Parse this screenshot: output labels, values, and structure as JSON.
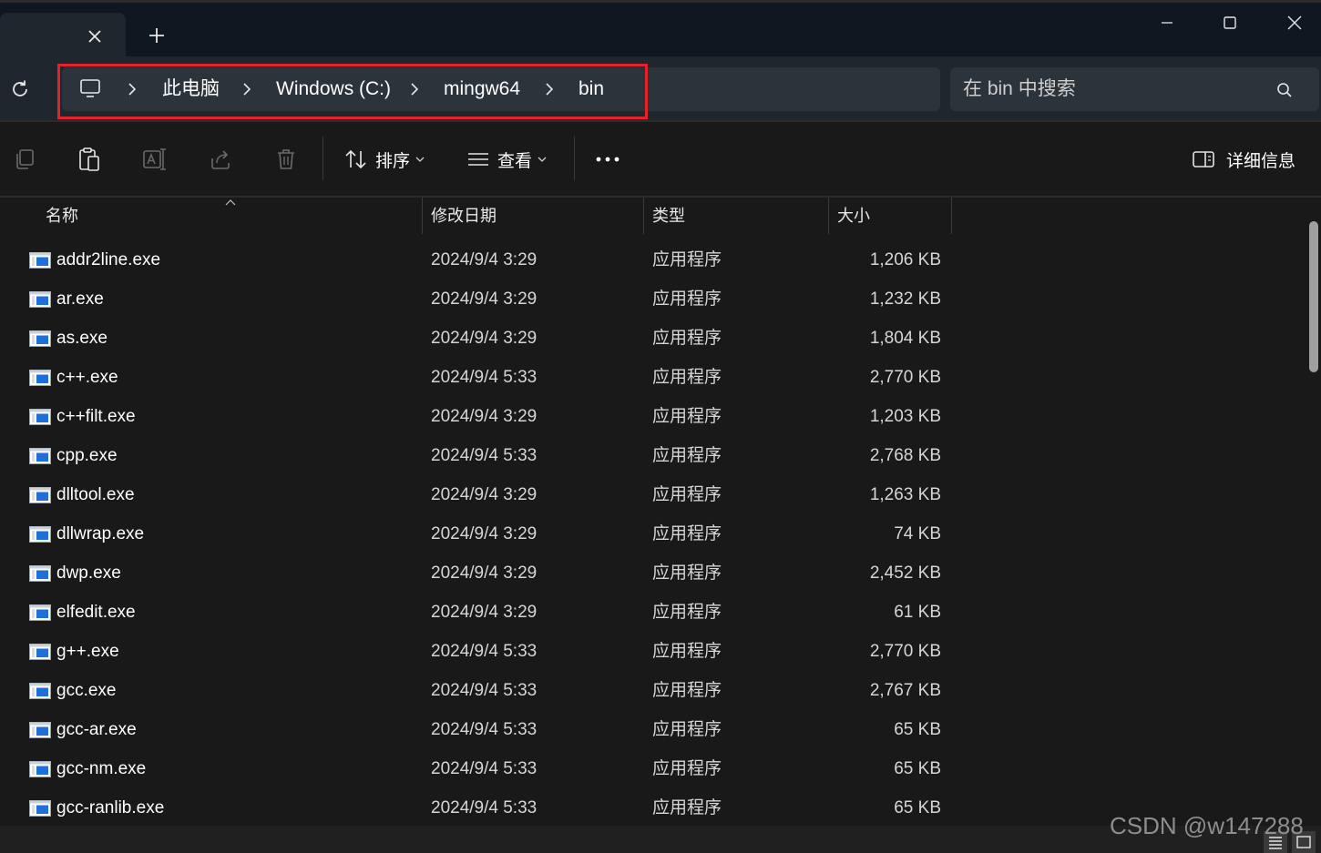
{
  "window": {
    "close_tab_label": "×",
    "new_tab_label": "+"
  },
  "address": {
    "crumbs": [
      "此电脑",
      "Windows (C:)",
      "mingw64",
      "bin"
    ]
  },
  "search": {
    "placeholder": "在 bin 中搜索"
  },
  "toolbar": {
    "sort_label": "排序",
    "view_label": "查看",
    "details_label": "详细信息"
  },
  "columns": {
    "name": "名称",
    "date": "修改日期",
    "type": "类型",
    "size": "大小"
  },
  "files": [
    {
      "name": "addr2line.exe",
      "date": "2024/9/4 3:29",
      "type": "应用程序",
      "size": "1,206 KB"
    },
    {
      "name": "ar.exe",
      "date": "2024/9/4 3:29",
      "type": "应用程序",
      "size": "1,232 KB"
    },
    {
      "name": "as.exe",
      "date": "2024/9/4 3:29",
      "type": "应用程序",
      "size": "1,804 KB"
    },
    {
      "name": "c++.exe",
      "date": "2024/9/4 5:33",
      "type": "应用程序",
      "size": "2,770 KB"
    },
    {
      "name": "c++filt.exe",
      "date": "2024/9/4 3:29",
      "type": "应用程序",
      "size": "1,203 KB"
    },
    {
      "name": "cpp.exe",
      "date": "2024/9/4 5:33",
      "type": "应用程序",
      "size": "2,768 KB"
    },
    {
      "name": "dlltool.exe",
      "date": "2024/9/4 3:29",
      "type": "应用程序",
      "size": "1,263 KB"
    },
    {
      "name": "dllwrap.exe",
      "date": "2024/9/4 3:29",
      "type": "应用程序",
      "size": "74 KB"
    },
    {
      "name": "dwp.exe",
      "date": "2024/9/4 3:29",
      "type": "应用程序",
      "size": "2,452 KB"
    },
    {
      "name": "elfedit.exe",
      "date": "2024/9/4 3:29",
      "type": "应用程序",
      "size": "61 KB"
    },
    {
      "name": "g++.exe",
      "date": "2024/9/4 5:33",
      "type": "应用程序",
      "size": "2,770 KB"
    },
    {
      "name": "gcc.exe",
      "date": "2024/9/4 5:33",
      "type": "应用程序",
      "size": "2,767 KB"
    },
    {
      "name": "gcc-ar.exe",
      "date": "2024/9/4 5:33",
      "type": "应用程序",
      "size": "65 KB"
    },
    {
      "name": "gcc-nm.exe",
      "date": "2024/9/4 5:33",
      "type": "应用程序",
      "size": "65 KB"
    },
    {
      "name": "gcc-ranlib.exe",
      "date": "2024/9/4 5:33",
      "type": "应用程序",
      "size": "65 KB"
    }
  ],
  "watermark": "CSDN @w147288",
  "colors": {
    "highlight_border": "#e5212b",
    "background": "#191919",
    "titlebar": "#0f1720",
    "address_row": "#1f262e",
    "exe_icon_blue": "#1e6fd9"
  }
}
